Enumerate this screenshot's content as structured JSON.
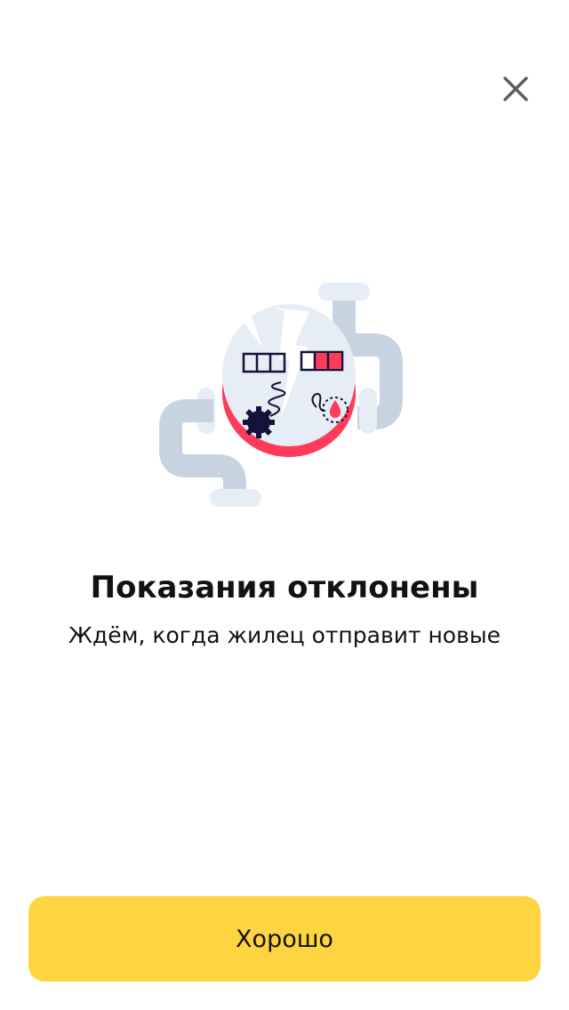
{
  "screen": {
    "title": "Показания отклонены",
    "subtitle": "Ждём, когда жилец отправит новые"
  },
  "actions": {
    "ok_label": "Хорошо"
  },
  "icons": {
    "close": "close-icon",
    "illustration": "broken-meter-illustration"
  },
  "colors": {
    "accent_button": "#fed440",
    "alert_red": "#ff3b5c",
    "pipe": "#c7d3e0"
  }
}
